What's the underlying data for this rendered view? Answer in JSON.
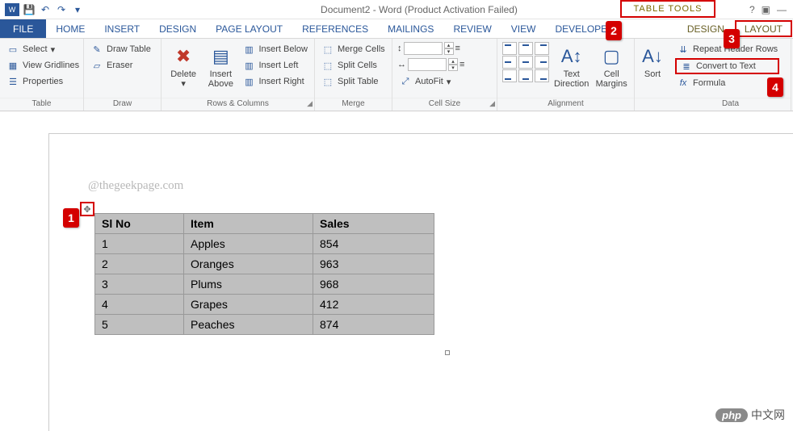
{
  "title": "Document2 - Word (Product Activation Failed)",
  "table_tools_label": "TABLE TOOLS",
  "tabs": {
    "file": "FILE",
    "home": "HOME",
    "insert": "INSERT",
    "design": "DESIGN",
    "page_layout": "PAGE LAYOUT",
    "references": "REFERENCES",
    "mailings": "MAILINGS",
    "review": "REVIEW",
    "view": "VIEW",
    "developer": "DEVELOPER",
    "ctx_design": "DESIGN",
    "ctx_layout": "LAYOUT"
  },
  "ribbon": {
    "table": {
      "label": "Table",
      "select": "Select",
      "view_gridlines": "View Gridlines",
      "properties": "Properties"
    },
    "draw": {
      "label": "Draw",
      "draw_table": "Draw Table",
      "eraser": "Eraser"
    },
    "rows_cols": {
      "label": "Rows & Columns",
      "delete": "Delete",
      "insert_above": "Insert Above",
      "insert_below": "Insert Below",
      "insert_left": "Insert Left",
      "insert_right": "Insert Right"
    },
    "merge": {
      "label": "Merge",
      "merge_cells": "Merge Cells",
      "split_cells": "Split Cells",
      "split_table": "Split Table"
    },
    "cell_size": {
      "label": "Cell Size",
      "autofit": "AutoFit",
      "height": "",
      "width": ""
    },
    "alignment": {
      "label": "Alignment",
      "text_direction": "Text Direction",
      "cell_margins": "Cell Margins"
    },
    "sort": "Sort",
    "data": {
      "label": "Data",
      "repeat_header": "Repeat Header Rows",
      "convert_to_text": "Convert to Text",
      "formula": "Formula"
    }
  },
  "callouts": {
    "c1": "1",
    "c2": "2",
    "c3": "3",
    "c4": "4"
  },
  "doc": {
    "watermark": "@thegeekpage.com",
    "headers": [
      "Sl No",
      "Item",
      "Sales"
    ],
    "rows": [
      [
        "1",
        "Apples",
        "854"
      ],
      [
        "2",
        "Oranges",
        "963"
      ],
      [
        "3",
        "Plums",
        "968"
      ],
      [
        "4",
        "Grapes",
        "412"
      ],
      [
        "5",
        "Peaches",
        "874"
      ]
    ]
  },
  "footer_brand": {
    "badge": "php",
    "text": "中文网"
  }
}
